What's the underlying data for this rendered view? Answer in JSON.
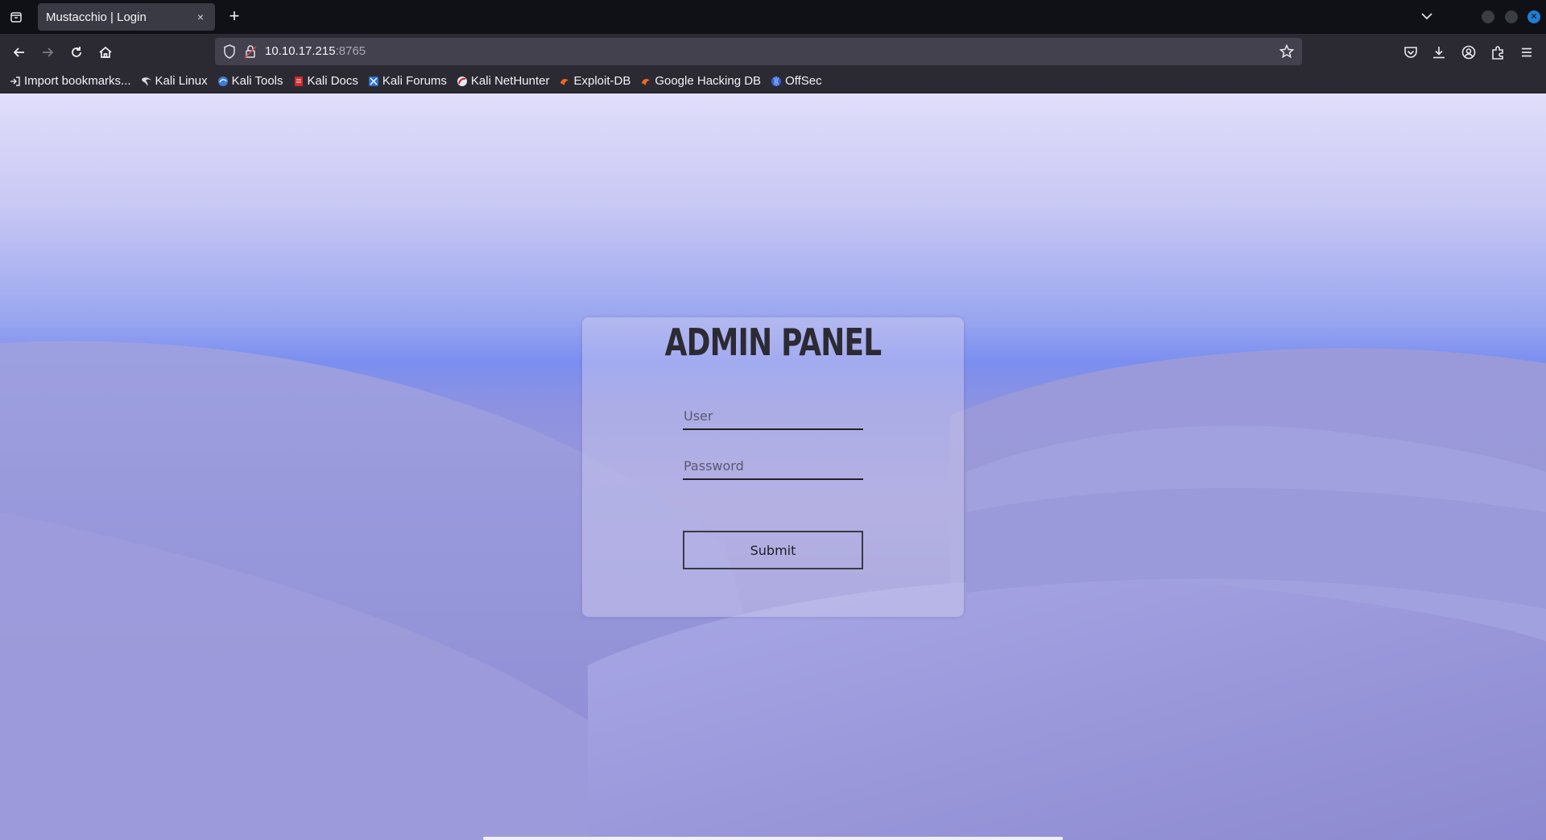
{
  "browser": {
    "tab_title": "Mustacchio | Login",
    "tab_close": "×",
    "newtab": "+",
    "url_host": "10.10.17.215",
    "url_port": ":8765"
  },
  "bookmarks": [
    {
      "label": "Import bookmarks...",
      "icon": "import-icon"
    },
    {
      "label": "Kali Linux",
      "icon": "kali-dragon-icon"
    },
    {
      "label": "Kali Tools",
      "icon": "kali-tools-icon"
    },
    {
      "label": "Kali Docs",
      "icon": "kali-docs-icon"
    },
    {
      "label": "Kali Forums",
      "icon": "kali-forums-icon"
    },
    {
      "label": "Kali NetHunter",
      "icon": "nethunter-icon"
    },
    {
      "label": "Exploit-DB",
      "icon": "exploitdb-icon"
    },
    {
      "label": "Google Hacking DB",
      "icon": "ghdb-icon"
    },
    {
      "label": "OffSec",
      "icon": "offsec-icon"
    }
  ],
  "login": {
    "title": "ADMIN PANEL",
    "user_placeholder": "User",
    "password_placeholder": "Password",
    "submit_label": "Submit"
  },
  "colors": {
    "chrome_dark": "#0f1116",
    "toolbar": "#2b2a33",
    "urlbar": "#42414d",
    "accent_close": "#1f7dd8",
    "sky_top": "#e0defa",
    "dune": "#9b98d8"
  }
}
